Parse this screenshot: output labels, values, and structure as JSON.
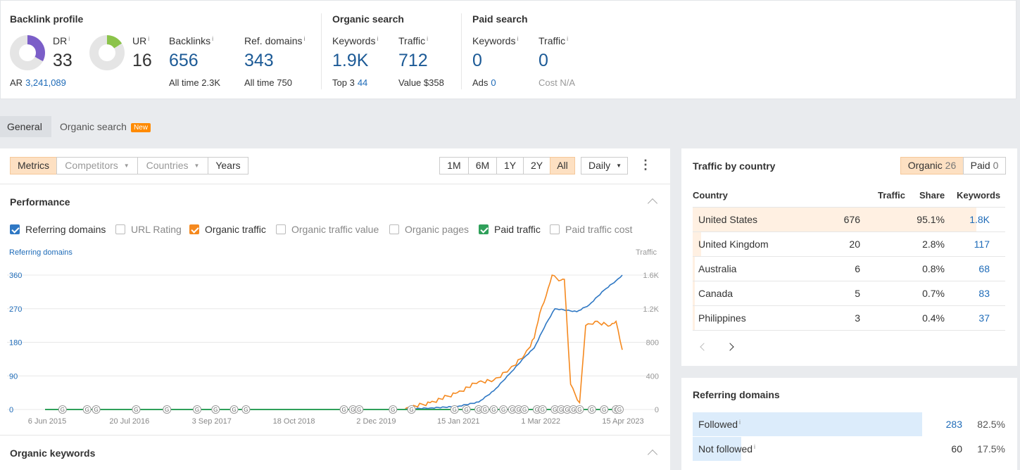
{
  "backlink": {
    "title": "Backlink profile",
    "dr_label": "DR",
    "dr_value": "33",
    "ur_label": "UR",
    "ur_value": "16",
    "ar_label": "AR",
    "ar_value": "3,241,089",
    "backlinks_label": "Backlinks",
    "backlinks_value": "656",
    "backlinks_sub_label": "All time",
    "backlinks_sub_value": "2.3K",
    "refdomains_label": "Ref. domains",
    "refdomains_value": "343",
    "refdomains_sub_label": "All time",
    "refdomains_sub_value": "750",
    "info_mark": "i"
  },
  "organic": {
    "title": "Organic search",
    "keywords_label": "Keywords",
    "keywords_value": "1.9K",
    "keywords_sub_label": "Top 3",
    "keywords_sub_value": "44",
    "traffic_label": "Traffic",
    "traffic_value": "712",
    "traffic_sub_label": "Value",
    "traffic_sub_value": "$358"
  },
  "paid": {
    "title": "Paid search",
    "keywords_label": "Keywords",
    "keywords_value": "0",
    "keywords_sub_label": "Ads",
    "keywords_sub_value": "0",
    "traffic_label": "Traffic",
    "traffic_value": "0",
    "traffic_sub_label": "Cost",
    "traffic_sub_value": "N/A"
  },
  "tabs": [
    {
      "label": "General"
    },
    {
      "label": "Organic search",
      "badge": "New"
    }
  ],
  "toolbar": {
    "metrics": "Metrics",
    "competitors": "Competitors",
    "countries": "Countries",
    "years": "Years",
    "ranges": [
      "1M",
      "6M",
      "1Y",
      "2Y",
      "All"
    ],
    "interval": "Daily",
    "more": "⋮"
  },
  "performance": {
    "title": "Performance",
    "checkboxes": [
      {
        "label": "Referring domains",
        "checked": true,
        "color": "#2f78c4"
      },
      {
        "label": "URL Rating",
        "checked": false
      },
      {
        "label": "Organic traffic",
        "checked": true,
        "color": "#f5891f"
      },
      {
        "label": "Organic traffic value",
        "checked": false
      },
      {
        "label": "Organic pages",
        "checked": false
      },
      {
        "label": "Paid traffic",
        "checked": true,
        "color": "#2fa05a"
      },
      {
        "label": "Paid traffic cost",
        "checked": false
      }
    ],
    "left_axis_title": "Referring domains",
    "right_axis_title": "Traffic"
  },
  "organic_keywords": {
    "title": "Organic keywords"
  },
  "traffic_by_country": {
    "title": "Traffic by country",
    "organic_label": "Organic",
    "organic_count": "26",
    "paid_label": "Paid",
    "paid_count": "0",
    "headers": [
      "Country",
      "Traffic",
      "Share",
      "Keywords"
    ],
    "rows": [
      {
        "country": "United States",
        "traffic": "676",
        "share": "95.1%",
        "keywords": "1.8K",
        "share_fraction": 0.951
      },
      {
        "country": "United Kingdom",
        "traffic": "20",
        "share": "2.8%",
        "keywords": "117",
        "share_fraction": 0.028
      },
      {
        "country": "Australia",
        "traffic": "6",
        "share": "0.8%",
        "keywords": "68",
        "share_fraction": 0.008
      },
      {
        "country": "Canada",
        "traffic": "5",
        "share": "0.7%",
        "keywords": "83",
        "share_fraction": 0.007
      },
      {
        "country": "Philippines",
        "traffic": "3",
        "share": "0.4%",
        "keywords": "37",
        "share_fraction": 0.004
      }
    ]
  },
  "referring_domains": {
    "title": "Referring domains",
    "rows": [
      {
        "label": "Followed",
        "count": "283",
        "percent": "82.5%",
        "fraction": 0.825
      },
      {
        "label": "Not followed",
        "count": "60",
        "percent": "17.5%",
        "fraction": 0.175
      }
    ]
  },
  "chart_data": {
    "type": "line",
    "x_tick_labels": [
      "6 Jun 2015",
      "20 Jul 2016",
      "3 Sep 2017",
      "18 Oct 2018",
      "2 Dec 2019",
      "15 Jan 2021",
      "1 Mar 2022",
      "15 Apr 2023"
    ],
    "x_range": [
      "2015-06-06",
      "2023-04-15"
    ],
    "left_axis": {
      "title": "Referring domains",
      "ticks": [
        "0",
        "90",
        "180",
        "270",
        "360"
      ],
      "range": [
        0,
        360
      ]
    },
    "right_axis": {
      "title": "Traffic",
      "ticks": [
        "0",
        "400",
        "800",
        "1.2K",
        "1.6K"
      ],
      "range": [
        0,
        1600
      ]
    },
    "grid": true,
    "annotation_marker": "G",
    "series": [
      {
        "name": "Referring domains",
        "color": "#2f78c4",
        "axis": "left",
        "points": [
          [
            "2020-05-01",
            1
          ],
          [
            "2020-09-01",
            4
          ],
          [
            "2021-01-15",
            8
          ],
          [
            "2021-05-01",
            20
          ],
          [
            "2021-07-15",
            50
          ],
          [
            "2021-10-01",
            95
          ],
          [
            "2021-12-15",
            140
          ],
          [
            "2022-02-01",
            165
          ],
          [
            "2022-04-01",
            230
          ],
          [
            "2022-05-15",
            270
          ],
          [
            "2022-09-01",
            262
          ],
          [
            "2022-11-01",
            280
          ],
          [
            "2023-01-15",
            320
          ],
          [
            "2023-03-15",
            345
          ],
          [
            "2023-04-15",
            360
          ]
        ]
      },
      {
        "name": "Organic traffic",
        "color": "#f5891f",
        "axis": "right",
        "points": [
          [
            "2020-05-01",
            10
          ],
          [
            "2020-09-01",
            80
          ],
          [
            "2021-01-15",
            200
          ],
          [
            "2021-05-01",
            330
          ],
          [
            "2021-07-15",
            350
          ],
          [
            "2021-10-01",
            480
          ],
          [
            "2021-12-15",
            650
          ],
          [
            "2022-02-01",
            850
          ],
          [
            "2022-03-01",
            1150
          ],
          [
            "2022-04-01",
            1350
          ],
          [
            "2022-05-01",
            1600
          ],
          [
            "2022-06-15",
            1540
          ],
          [
            "2022-07-01",
            1550
          ],
          [
            "2022-08-01",
            300
          ],
          [
            "2022-09-15",
            80
          ],
          [
            "2022-10-15",
            1000
          ],
          [
            "2022-12-01",
            1050
          ],
          [
            "2023-02-15",
            1000
          ],
          [
            "2023-03-15",
            1050
          ],
          [
            "2023-04-15",
            710
          ]
        ]
      },
      {
        "name": "Paid traffic",
        "color": "#2fa05a",
        "axis": "right",
        "points": [
          [
            "2015-06-06",
            0
          ],
          [
            "2023-04-15",
            0
          ]
        ]
      }
    ],
    "annotation_dates": [
      "2015-09-01",
      "2016-01-01",
      "2016-02-15",
      "2016-09-01",
      "2017-02-01",
      "2017-07-01",
      "2017-10-01",
      "2018-01-01",
      "2018-03-01",
      "2019-07-01",
      "2019-08-15",
      "2019-09-15",
      "2020-03-01",
      "2020-06-01",
      "2021-01-01",
      "2021-03-01",
      "2021-05-01",
      "2021-06-01",
      "2021-07-15",
      "2021-09-01",
      "2021-10-15",
      "2021-11-15",
      "2021-12-15",
      "2022-02-15",
      "2022-03-15",
      "2022-05-15",
      "2022-06-15",
      "2022-07-15",
      "2022-08-15",
      "2022-09-15",
      "2022-11-15",
      "2023-01-15",
      "2023-03-15",
      "2023-04-01"
    ]
  }
}
